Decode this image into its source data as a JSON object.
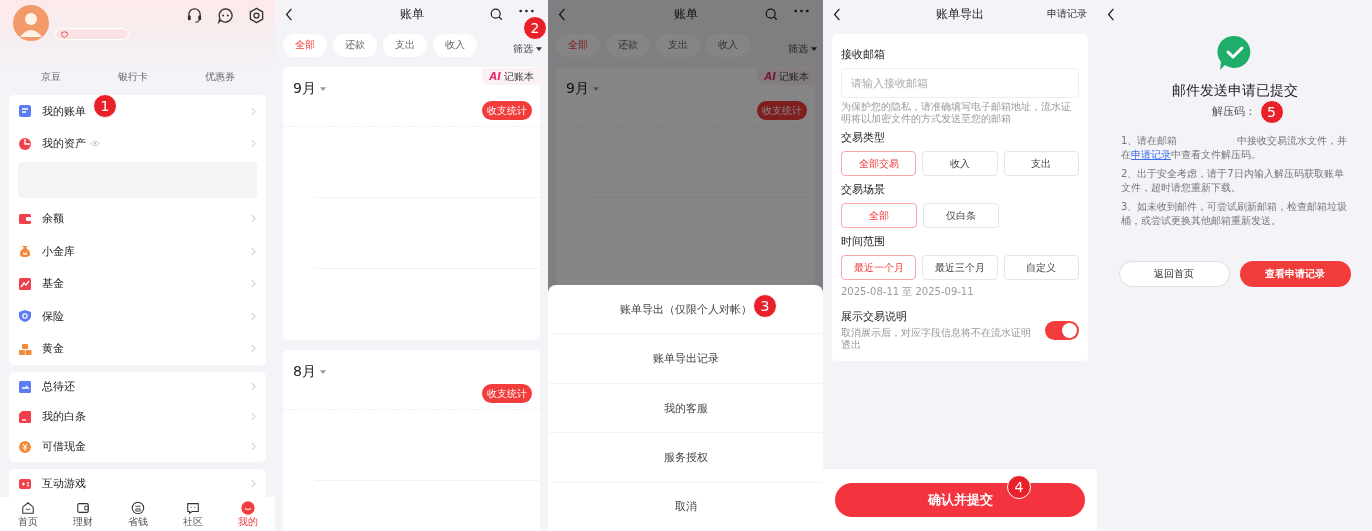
{
  "profile": {
    "step": "1",
    "tabs": [
      "京豆",
      "银行卡",
      "优惠券"
    ],
    "groups": [
      [
        {
          "label": "我的账单",
          "kind": "doc",
          "color": "#5b7cf5"
        },
        {
          "label": "我的资产",
          "kind": "pie",
          "color": "#f0404a",
          "eye": true,
          "panel": true
        },
        {
          "label": "余额",
          "kind": "wallet",
          "color": "#f0404a"
        },
        {
          "label": "小金库",
          "kind": "bag",
          "color": "#f5893a"
        },
        {
          "label": "基金",
          "kind": "chart",
          "color": "#f0404a"
        },
        {
          "label": "保险",
          "kind": "shield",
          "color": "#5b7cf5"
        },
        {
          "label": "黄金",
          "kind": "bars",
          "color": "#f5893a"
        }
      ],
      [
        {
          "label": "总待还",
          "kind": "pay",
          "color": "#5b7cf5"
        },
        {
          "label": "我的白条",
          "kind": "card",
          "color": "#f0404a"
        },
        {
          "label": "可借现金",
          "kind": "coin",
          "color": "#f5893a"
        }
      ],
      [
        {
          "label": "互动游戏",
          "kind": "game",
          "color": "#f0404a"
        }
      ]
    ],
    "nav": [
      {
        "label": "首页",
        "kind": "home",
        "selected": false
      },
      {
        "label": "理财",
        "kind": "wallet",
        "selected": false
      },
      {
        "label": "省钱",
        "kind": "coin",
        "selected": false
      },
      {
        "label": "社区",
        "kind": "chat",
        "selected": false
      },
      {
        "label": "我的",
        "kind": "me",
        "selected": true
      }
    ]
  },
  "bills": {
    "title": "账单",
    "step": "2",
    "filter_button": "筛选",
    "ai_mark": "AI",
    "ai_label": "记账本",
    "filters": [
      {
        "label": "全部",
        "selected": true
      },
      {
        "label": "还款",
        "selected": false
      },
      {
        "label": "支出",
        "selected": false
      },
      {
        "label": "收入",
        "selected": false
      }
    ],
    "months": [
      {
        "month": "9月",
        "stats_button": "收支统计"
      },
      {
        "month": "8月",
        "stats_button": "收支统计"
      }
    ]
  },
  "bills_behind_sheet": {
    "title": "账单",
    "filter_button": "筛选",
    "ai_mark": "AI",
    "ai_label": "记账本",
    "filters": [
      {
        "label": "全部",
        "selected": true
      },
      {
        "label": "还款",
        "selected": false
      },
      {
        "label": "支出",
        "selected": false
      },
      {
        "label": "收入",
        "selected": false
      }
    ],
    "months": [
      {
        "month": "9月",
        "stats_button": "收支统计"
      }
    ],
    "sheet": {
      "step": "3",
      "options": [
        "账单导出（仅限个人对帐）",
        "账单导出记录",
        "我的客服",
        "服务授权",
        "取消"
      ]
    }
  },
  "export": {
    "title": "账单导出",
    "link": "申请记录",
    "step": "4",
    "submit": "确认并提交",
    "email": {
      "label": "接收邮箱",
      "placeholder": "请输入接收邮箱",
      "hint": "为保护您的隐私，请准确填写电子邮箱地址，流水证明将以加密文件的方式发送至您的邮箱"
    },
    "sections": [
      {
        "label": "交易类型",
        "options": [
          {
            "label": "全部交易",
            "selected": true
          },
          {
            "label": "收入",
            "selected": false
          },
          {
            "label": "支出",
            "selected": false
          }
        ]
      },
      {
        "label": "交易场景",
        "options": [
          {
            "label": "全部",
            "selected": true
          },
          {
            "label": "仅白条",
            "selected": false
          }
        ]
      },
      {
        "label": "时间范围",
        "options": [
          {
            "label": "最近一个月",
            "selected": true
          },
          {
            "label": "最近三个月",
            "selected": false
          },
          {
            "label": "自定义",
            "selected": false
          }
        ],
        "note": "2025-08-11 至 2025-09-11"
      }
    ],
    "toggle": {
      "label": "展示交易说明",
      "hint": "取消展示后，对应字段信息将不在流水证明透出",
      "on": true
    }
  },
  "result": {
    "title": "邮件发送申请已提交",
    "code_label": "解压码：",
    "step": "5",
    "notes": [
      {
        "parts": [
          {
            "text": "1、请在邮箱"
          },
          {
            "kind": "blank"
          },
          {
            "text": "中接收交易流水文件，并在"
          },
          {
            "kind": "link",
            "text": "申请记录"
          },
          {
            "text": "中查看文件解压码。"
          }
        ]
      },
      {
        "parts": [
          {
            "text": "2、出于安全考虑，请于7日内输入解压码获取账单文件，超时请您重新下载。"
          }
        ]
      },
      {
        "parts": [
          {
            "text": "3、如未收到邮件，可尝试刷新邮箱，检查邮箱垃圾桶，或尝试更换其他邮箱重新发送。"
          }
        ]
      }
    ],
    "buttons": [
      {
        "label": "返回首页",
        "kind": "secondary"
      },
      {
        "label": "查看申请记录",
        "kind": "primary"
      }
    ]
  }
}
